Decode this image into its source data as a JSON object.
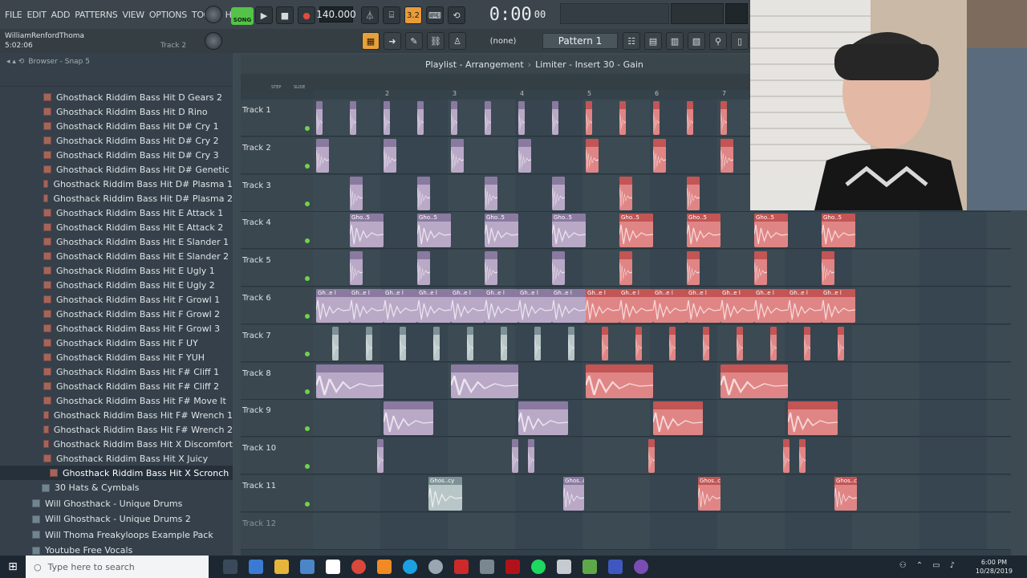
{
  "menu": [
    "FILE",
    "EDIT",
    "ADD",
    "PATTERNS",
    "VIEW",
    "OPTIONS",
    "TOOLS",
    "HELP"
  ],
  "transport": {
    "mode_label": "SONG",
    "tempo": "140.000",
    "time_main": "0:00",
    "time_sub": "00",
    "beat_value": "3.2"
  },
  "hint": {
    "user": "WilliamRenfordThoma",
    "time": "5:02:06",
    "track": "Track 2"
  },
  "toolbar2": {
    "none_label": "(none)",
    "pattern_label": "Pattern 1"
  },
  "browser": {
    "title": "Browser - Snap 5",
    "items": [
      "Ghosthack Riddim Bass Hit D Gears 2",
      "Ghosthack Riddim Bass Hit D Rino",
      "Ghosthack Riddim Bass Hit D# Cry 1",
      "Ghosthack Riddim Bass Hit D# Cry 2",
      "Ghosthack Riddim Bass Hit D# Cry 3",
      "Ghosthack Riddim Bass Hit D# Genetic",
      "Ghosthack Riddim Bass Hit D# Plasma 1",
      "Ghosthack Riddim Bass Hit D# Plasma 2",
      "Ghosthack Riddim Bass Hit E Attack 1",
      "Ghosthack Riddim Bass Hit E Attack 2",
      "Ghosthack Riddim Bass Hit E Slander 1",
      "Ghosthack Riddim Bass Hit E Slander 2",
      "Ghosthack Riddim Bass Hit E Ugly 1",
      "Ghosthack Riddim Bass Hit E Ugly 2",
      "Ghosthack Riddim Bass Hit F Growl 1",
      "Ghosthack Riddim Bass Hit F Growl 2",
      "Ghosthack Riddim Bass Hit F Growl 3",
      "Ghosthack Riddim Bass Hit F UY",
      "Ghosthack Riddim Bass Hit F YUH",
      "Ghosthack Riddim Bass Hit F# Cliff 1",
      "Ghosthack Riddim Bass Hit F# Cliff 2",
      "Ghosthack Riddim Bass Hit F# Move It",
      "Ghosthack Riddim Bass Hit F# Wrench 1",
      "Ghosthack Riddim Bass Hit F# Wrench 2",
      "Ghosthack Riddim Bass Hit X Discomfort",
      "Ghosthack Riddim Bass Hit X Juicy",
      "Ghosthack Riddim Bass Hit X Scronch"
    ],
    "folders": [
      "30 Hats & Cymbals",
      "Will Ghosthack - Unique Drums",
      "Will Ghosthack - Unique Drums 2",
      "Will Thoma Freakyloops Example Pack",
      "Youtube Free Vocals"
    ]
  },
  "playlist": {
    "title": "Playlist - Arrangement",
    "breadcrumb": "Limiter - Insert 30 - Gain",
    "snap_labels": [
      "STEP",
      "SLIDE"
    ],
    "ruler": [
      "2",
      "3",
      "4",
      "5",
      "6",
      "7"
    ],
    "tracks": [
      "Track 1",
      "Track 2",
      "Track 3",
      "Track 4",
      "Track 5",
      "Track 6",
      "Track 7",
      "Track 8",
      "Track 9",
      "Track 10",
      "Track 11",
      "Track 12"
    ],
    "clip_labels": {
      "ghost5": "Gho..5",
      "ghel": "Gh..e l",
      "ghoscy": "Ghos..cy"
    }
  },
  "taskbar": {
    "search_placeholder": "Type here to search",
    "time": "6:00 PM",
    "date": "10/28/2019"
  },
  "colors": {
    "accent_song": "#55c24a",
    "clip_purple": "#b9a9c7",
    "clip_red": "#e08585",
    "record": "#d4423a"
  }
}
